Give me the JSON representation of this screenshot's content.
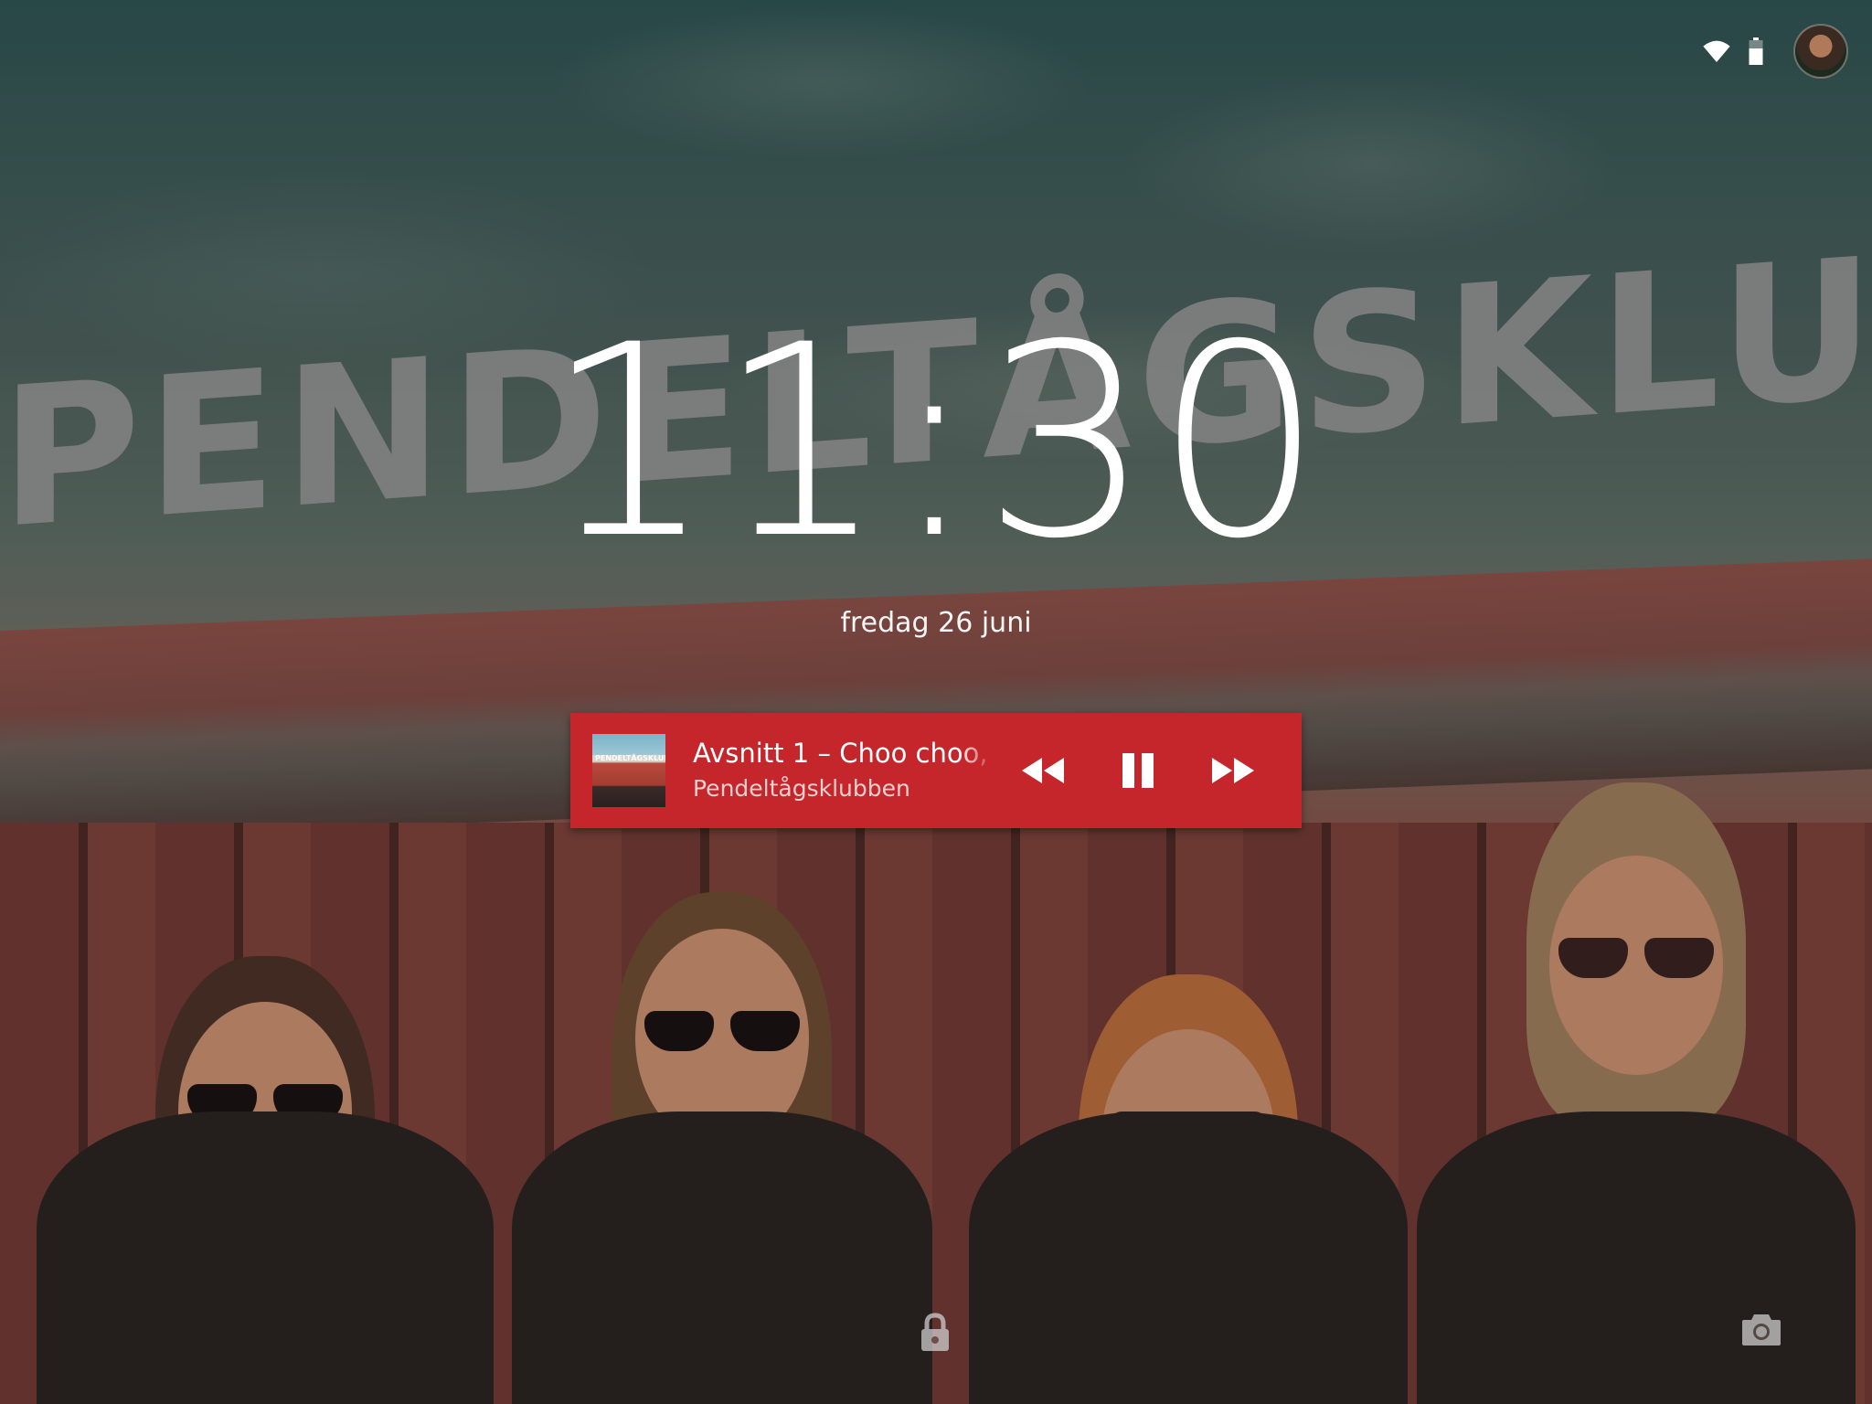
{
  "status_bar": {
    "wifi_icon": "wifi-icon",
    "battery_icon": "battery-icon",
    "avatar_icon": "user-avatar"
  },
  "background": {
    "text": "PENDELTÅGSKLUBBEN"
  },
  "clock": {
    "time": "11:30",
    "date": "fredag 26 juni"
  },
  "media": {
    "title": "Avsnitt 1 – Choo choo,",
    "artist": "Pendeltågsklubben",
    "art_text": "PENDELTÅGSKLUBBEN",
    "accent_color": "#c4262b",
    "controls": [
      {
        "name": "rewind",
        "icon": "rewind-icon"
      },
      {
        "name": "pause",
        "icon": "pause-icon"
      },
      {
        "name": "fast-forward",
        "icon": "fast-forward-icon"
      }
    ]
  },
  "bottom": {
    "lock_icon": "lock-icon",
    "camera_icon": "camera-icon"
  }
}
